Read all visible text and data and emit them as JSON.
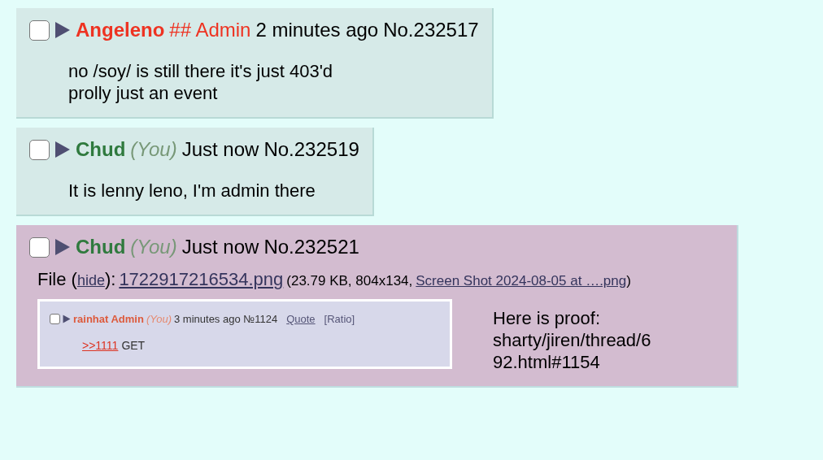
{
  "posts": [
    {
      "name": "Angeleno",
      "capcode": "## Admin",
      "time": "2 minutes ago",
      "number": "No.232517",
      "kind": "admin",
      "highlighted": false,
      "checked": false,
      "lines": [
        "no /soy/ is still there it's just 403'd",
        "prolly just an event"
      ]
    },
    {
      "name": "Chud",
      "you": "(You)",
      "time": "Just now",
      "number": "No.232519",
      "kind": "user",
      "highlighted": false,
      "checked": false,
      "lines": [
        "It is lenny leno, I'm admin there"
      ]
    },
    {
      "name": "Chud",
      "you": "(You)",
      "time": "Just now",
      "number": "No.232521",
      "kind": "user",
      "highlighted": true,
      "checked": false,
      "file": {
        "label": "File (",
        "hide_link": "hide",
        "after_hide": "):",
        "filename": "1722917216534.png",
        "info_open": "(23.79 KB, 804x134,",
        "original_name": "Screen Shot 2024-08-05 at ….png",
        "info_close": ")"
      },
      "embedded": {
        "name": "rainhat Admin",
        "you": "(You)",
        "time_number": "3 minutes ago №1124",
        "quote": "Quote",
        "ratio": "[Ratio]",
        "reply_link": ">>1111",
        "body": "GET"
      },
      "lines": [
        "Here is proof:",
        "sharty/jiren/thread/6",
        "92.html#1154"
      ]
    }
  ]
}
